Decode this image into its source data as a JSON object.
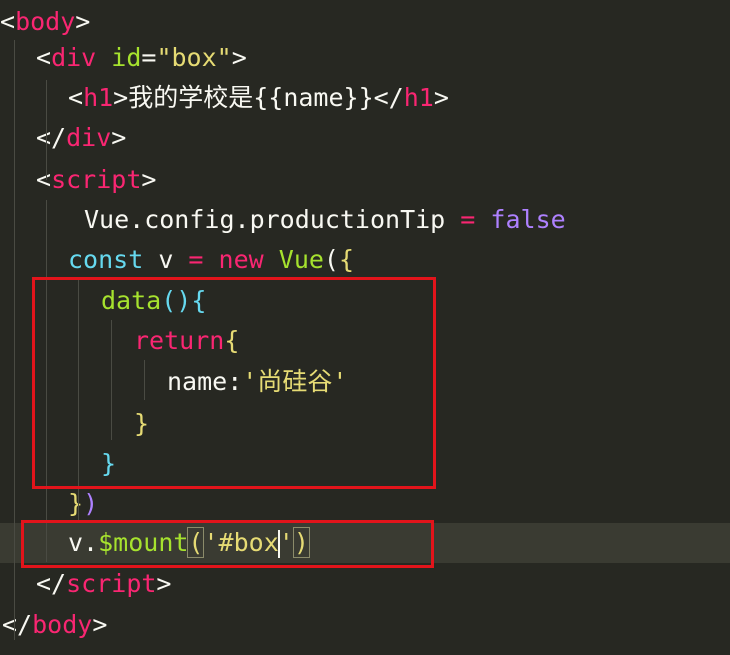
{
  "editor": {
    "lines": [
      [
        [
          "<",
          "#f8f8f2"
        ],
        [
          "body",
          "#f92672"
        ],
        [
          ">",
          "#f8f8f2"
        ]
      ],
      [
        [
          "<",
          "#f8f8f2"
        ],
        [
          "div",
          "#f92672"
        ],
        [
          " ",
          "#f8f8f2"
        ],
        [
          "id",
          "#a6e22e"
        ],
        [
          "=",
          "#f8f8f2"
        ],
        [
          "\"box\"",
          "#e6db74"
        ],
        [
          ">",
          "#f8f8f2"
        ]
      ],
      [
        [
          "<",
          "#f8f8f2"
        ],
        [
          "h1",
          "#f92672"
        ],
        [
          ">我的学校是{{name}}</",
          "#f8f8f2"
        ],
        [
          "h1",
          "#f92672"
        ],
        [
          ">",
          "#f8f8f2"
        ]
      ],
      [
        [
          "</",
          "#f8f8f2"
        ],
        [
          "div",
          "#f92672"
        ],
        [
          ">",
          "#f8f8f2"
        ]
      ],
      [
        [
          "<",
          "#f8f8f2"
        ],
        [
          "script",
          "#f92672"
        ],
        [
          ">",
          "#f8f8f2"
        ]
      ],
      [
        [
          "Vue.config.productionTip ",
          "#f8f8f2"
        ],
        [
          "=",
          "#f92672"
        ],
        [
          " ",
          "#f8f8f2"
        ],
        [
          "false",
          "#ae81ff"
        ]
      ],
      [
        [
          "const",
          "#66d9ef"
        ],
        [
          " v ",
          "#f8f8f2"
        ],
        [
          "=",
          "#f92672"
        ],
        [
          " ",
          "#f8f8f2"
        ],
        [
          "new",
          "#f92672"
        ],
        [
          " ",
          "#f8f8f2"
        ],
        [
          "Vue",
          "#a6e22e"
        ],
        [
          "(",
          "#f8f8f2"
        ],
        [
          "{",
          "#e6db74"
        ]
      ],
      [
        [
          "data",
          "#a6e22e"
        ],
        [
          "()",
          "#66d9ef"
        ],
        [
          "{",
          "#66d9ef"
        ]
      ],
      [
        [
          "return",
          "#f92672"
        ],
        [
          "{",
          "#e6db74"
        ]
      ],
      [
        [
          "name:",
          "#f8f8f2"
        ],
        [
          "'尚硅谷'",
          "#e6db74"
        ]
      ],
      [
        [
          "}",
          "#e6db74"
        ]
      ],
      [
        [
          "}",
          "#66d9ef"
        ]
      ],
      [
        [
          "}",
          "#e6db74"
        ],
        [
          ")",
          "#ae81ff"
        ]
      ],
      [
        [
          "v.",
          "#f8f8f2"
        ],
        [
          "$mount",
          "#a6e22e"
        ],
        [
          "(",
          "#e6db74"
        ],
        [
          "'#box",
          "#e6db74"
        ],
        [
          "|caret|",
          "#f8f8f0"
        ],
        [
          "'",
          "#e6db74"
        ],
        [
          ")",
          "#e6db74"
        ]
      ],
      [
        [
          "</",
          "#f8f8f2"
        ],
        [
          "script",
          "#f92672"
        ],
        [
          ">",
          "#f8f8f2"
        ]
      ],
      [
        [
          "</",
          "#f8f8f2"
        ],
        [
          "body",
          "#f92672"
        ],
        [
          ">",
          "#f8f8f2"
        ]
      ]
    ]
  },
  "colors": {
    "background": "#272822",
    "highlight_box": "#e2141b",
    "current_line": "#3a3b32"
  }
}
